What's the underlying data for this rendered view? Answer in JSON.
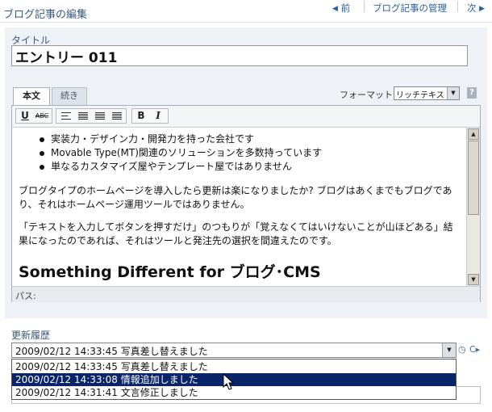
{
  "header": {
    "title": "ブログ記事の編集",
    "prev": "前",
    "manage": "ブログ記事の管理",
    "next": "次"
  },
  "title_field": {
    "label": "タイトル",
    "value": "エントリー 011"
  },
  "tabs": [
    {
      "label": "本文",
      "active": true
    },
    {
      "label": "続き",
      "active": false
    }
  ],
  "format": {
    "label": "フォーマット:",
    "value": "リッチテキスト",
    "help": "?"
  },
  "toolbar": {
    "underline": "U",
    "strike": "ABC",
    "bold": "B",
    "italic": "I"
  },
  "editor": {
    "bullets": [
      "実装力・デザイン力・開発力を持った会社です",
      "Movable Type(MT)関連のソリューションを多数持っています",
      "単なるカスタマイズ屋やテンプレート屋ではありません"
    ],
    "para1": "ブログタイプのホームページを導入したら更新は楽になりましたか? ブログはあくまでもブログであり、それはホームページ運用ツールではありません。",
    "para2": "「テキストを入力してボタンを押すだけ」のつもりが「覚えなくてはいけないことが山ほどある」結果になったのであれば、それはツールと発注先の選択を間違えたのです。",
    "heading": "Something Different for ブログ･CMS",
    "path_label": "パス:"
  },
  "history": {
    "label": "更新履歴",
    "selected": "2009/02/12 14:33:45  写真差し替えました",
    "options": [
      "2009/02/12 14:33:45  写真差し替えました",
      "2009/02/12 14:33:08  情報追加しました",
      "2009/02/12 14:31:41  文言修正しました"
    ],
    "highlighted_index": 1
  },
  "colors": {
    "accent_link": "#2a5fa3",
    "label": "#3b5775",
    "selection": "#0a246a"
  }
}
